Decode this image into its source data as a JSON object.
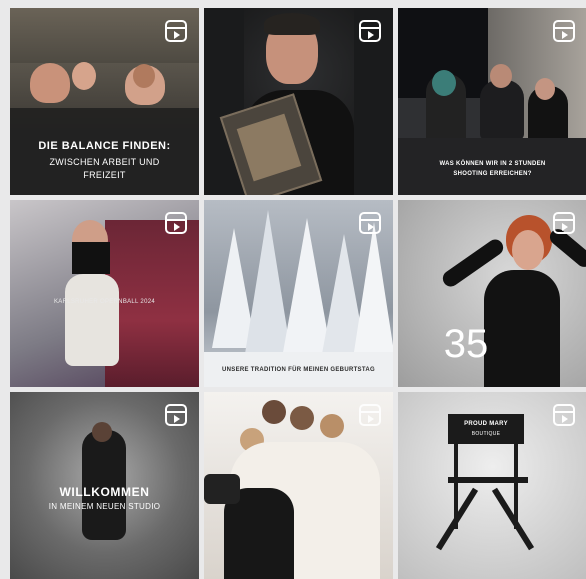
{
  "tiles": [
    {
      "caption_title": "DIE BALANCE FINDEN:",
      "caption_lines": [
        "ZWISCHEN ARBEIT UND",
        "FREIZEIT"
      ]
    },
    {
      "caption_title": "",
      "caption_lines": []
    },
    {
      "caption_title": "",
      "caption_lines": [
        "WAS KÖNNEN WIR IN 2 STUNDEN",
        "SHOOTING ERREICHEN?"
      ]
    },
    {
      "caption_title": "",
      "caption_lines": [
        "KARLSRUHER OPERNBALL 2024"
      ]
    },
    {
      "caption_title": "",
      "caption_lines": [
        "UNSERE TRADITION FÜR MEINEN GEBURTSTAG"
      ]
    },
    {
      "caption_title": "35",
      "caption_lines": []
    },
    {
      "caption_title": "WILLKOMMEN",
      "caption_lines": [
        "IN MEINEM NEUEN STUDIO"
      ]
    },
    {
      "caption_title": "",
      "caption_lines": []
    },
    {
      "caption_title": "",
      "caption_lines": [
        "PROUD MARY",
        "BOUTIQUE"
      ]
    }
  ],
  "icons": {
    "reel": "reels-icon"
  }
}
